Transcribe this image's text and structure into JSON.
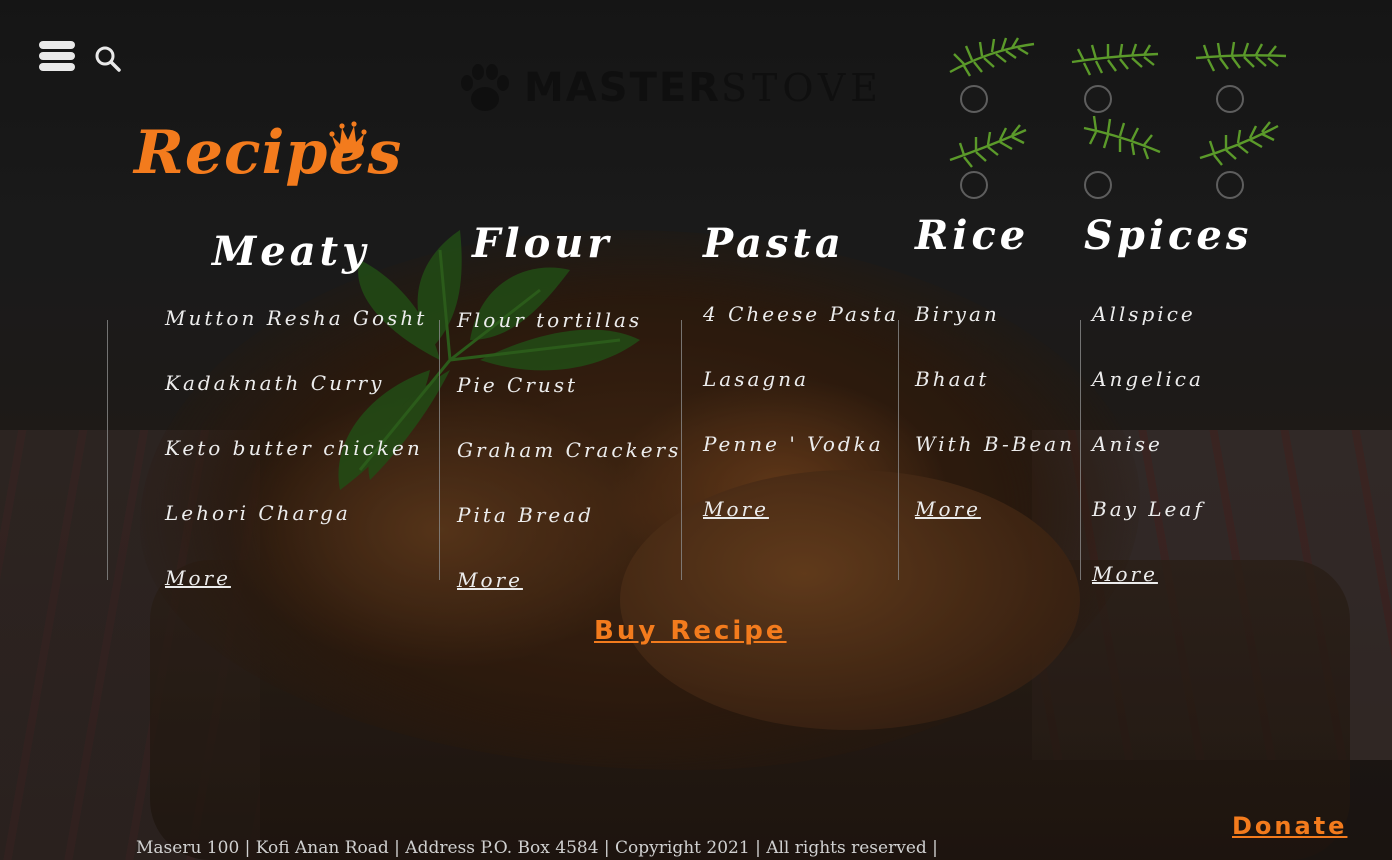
{
  "header": {
    "logo_bold": "MASTER",
    "logo_light": "STOVE",
    "icons": [
      "menu-icon",
      "search-icon",
      "paw-icon"
    ]
  },
  "title": {
    "text": "Recipes",
    "icon": "crown-icon",
    "color": "#f37b1d"
  },
  "swatches": {
    "icon": "rosemary-icon",
    "count": 6
  },
  "columns": [
    {
      "heading": "Meaty",
      "items": [
        "Mutton Resha Gosht",
        "Kadaknath Curry",
        "Keto butter chicken",
        "Lehori Charga"
      ],
      "more": "More"
    },
    {
      "heading": "Flour",
      "items": [
        "Flour tortillas",
        "Pie Crust",
        "Graham Crackers",
        "Pita Bread"
      ],
      "more": "More"
    },
    {
      "heading": "Pasta",
      "items": [
        "4 Cheese Pasta",
        "Lasagna",
        "Penne ' Vodka"
      ],
      "more": "More"
    },
    {
      "heading": "Rice",
      "items": [
        "Biryan",
        "Bhaat",
        "With B-Bean"
      ],
      "more": "More"
    },
    {
      "heading": "Spices",
      "items": [
        "Allspice",
        "Angelica",
        "Anise",
        "Bay Leaf"
      ],
      "more": "More"
    }
  ],
  "actions": {
    "buy": "Buy Recipe",
    "donate": "Donate"
  },
  "footer": {
    "text": "Maseru 100 | Kofi Anan Road | Address P.O. Box 4584 | Copyright 2021 | All rights reserved |"
  },
  "colors": {
    "accent": "#f37b1d",
    "text": "#ececec"
  }
}
